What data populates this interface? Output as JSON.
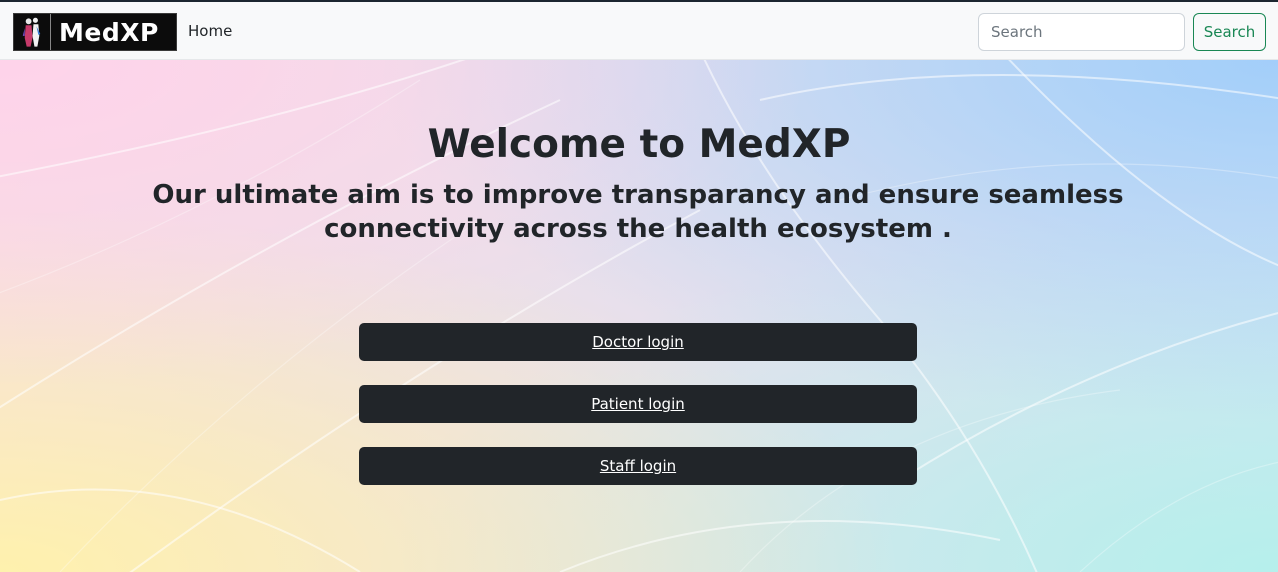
{
  "navbar": {
    "brand": "MedXP",
    "home_link": "Home",
    "search": {
      "placeholder": "Search",
      "value": "",
      "button_label": "Search"
    }
  },
  "hero": {
    "title": "Welcome to MedXP",
    "subtitle": "Our ultimate aim is to improve transparancy and ensure seamless connectivity across the health ecosystem ."
  },
  "login_buttons": {
    "doctor": "Doctor login",
    "patient": "Patient login",
    "staff": "Staff login"
  },
  "colors": {
    "navbar_bg": "#f8f9fa",
    "button_dark": "#212529",
    "search_outline_green": "#198754",
    "text_dark": "#212529"
  },
  "icons": {
    "logo_mark": "medical-figures-icon"
  }
}
